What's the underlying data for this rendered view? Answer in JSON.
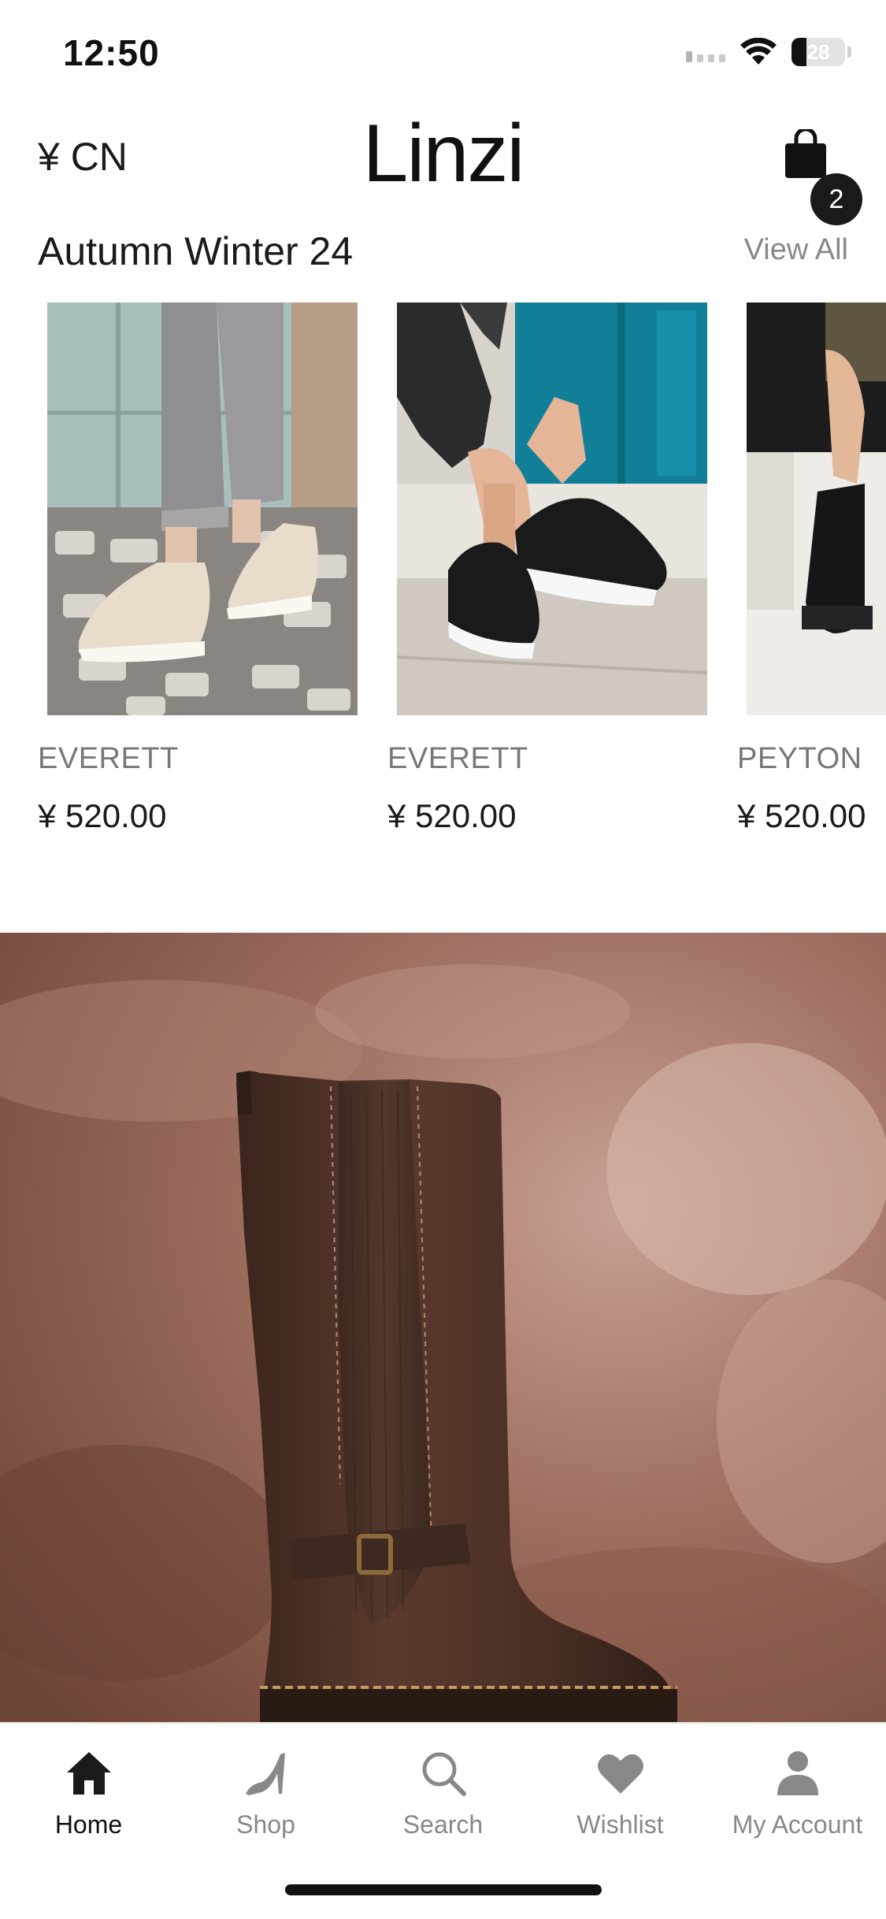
{
  "status_bar": {
    "time": "12:50",
    "battery_percent": "28",
    "battery_level": 0.28
  },
  "header": {
    "currency": "¥ CN",
    "logo": "Linzi",
    "cart_count": "2"
  },
  "section": {
    "title": "Autumn Winter 24",
    "view_all": "View All"
  },
  "products": [
    {
      "name": "EVERETT",
      "price": "¥ 520.00",
      "color": "cream"
    },
    {
      "name": "EVERETT",
      "price": "¥ 520.00",
      "color": "black"
    },
    {
      "name": "PEYTON",
      "price": "¥ 520.00",
      "color": "black"
    }
  ],
  "tabs": [
    {
      "label": "Home",
      "icon": "house-icon",
      "active": true
    },
    {
      "label": "Shop",
      "icon": "high-heel-icon",
      "active": false
    },
    {
      "label": "Search",
      "icon": "magnifier-icon",
      "active": false
    },
    {
      "label": "Wishlist",
      "icon": "heart-icon",
      "active": false
    },
    {
      "label": "My Account",
      "icon": "person-icon",
      "active": false
    }
  ],
  "colors": {
    "brand_text": "#111111",
    "muted_text": "#888888",
    "banner_bg": "#8a5a4a",
    "boot_brown": "#4a2f25"
  }
}
